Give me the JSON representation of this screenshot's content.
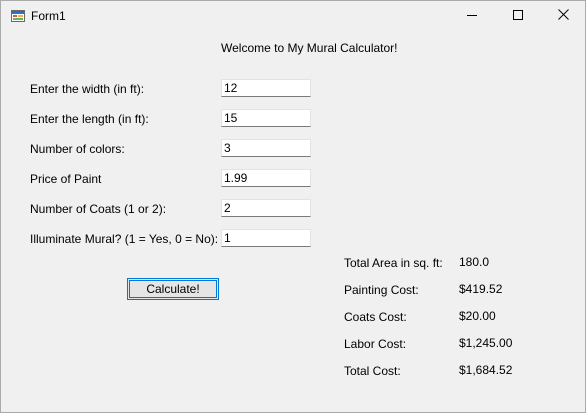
{
  "window": {
    "title": "Form1"
  },
  "header": {
    "welcome": "Welcome to My Mural Calculator!"
  },
  "inputs": [
    {
      "label": "Enter the width (in ft):",
      "value": "12"
    },
    {
      "label": "Enter the length (in ft):",
      "value": "15"
    },
    {
      "label": "Number of colors:",
      "value": "3"
    },
    {
      "label": "Price of Paint",
      "value": "1.99"
    },
    {
      "label": "Number of Coats (1 or 2):",
      "value": "2"
    },
    {
      "label": "Illuminate Mural? (1 = Yes, 0 = No):",
      "value": "1"
    }
  ],
  "actions": {
    "calculate_label": "Calculate!"
  },
  "results": [
    {
      "label": "Total Area in sq. ft:",
      "value": "180.0"
    },
    {
      "label": "Painting Cost:",
      "value": "$419.52"
    },
    {
      "label": "Coats Cost:",
      "value": "$20.00"
    },
    {
      "label": "Labor Cost:",
      "value": "$1,245.00"
    },
    {
      "label": "Total Cost:",
      "value": "$1,684.52"
    }
  ],
  "icons": {
    "app": "form-app-icon",
    "minimize": "minimize-icon",
    "maximize": "maximize-icon",
    "close": "close-icon"
  }
}
